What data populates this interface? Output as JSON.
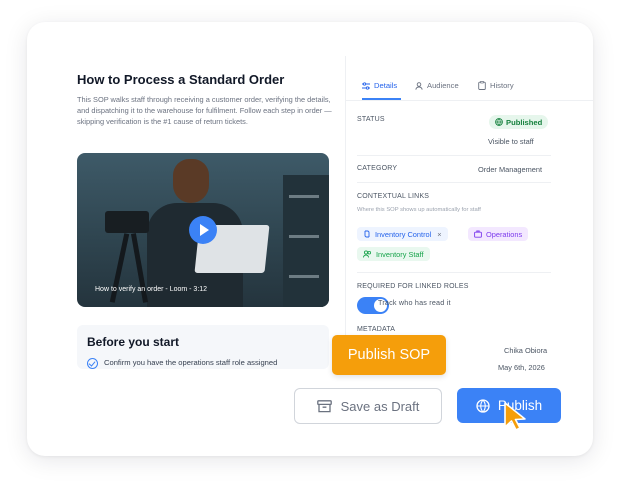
{
  "sop": {
    "title": "How to Process a Standard Order",
    "description": "This SOP walks staff through receiving a customer order, verifying the details, and dispatching it to the warehouse for fulfilment. Follow each step in order — skipping verification is the #1 cause of return tickets.",
    "video_caption": "How to verify an order - Loom - 3:12",
    "before_title": "Before you start",
    "checklist_item": "Confirm you have the operations staff role assigned"
  },
  "tabs": [
    {
      "label": "Details",
      "icon": "sliders-icon",
      "active": true
    },
    {
      "label": "Audience",
      "icon": "user-icon",
      "active": false
    },
    {
      "label": "History",
      "icon": "clipboard-icon",
      "active": false
    }
  ],
  "details": {
    "status_label": "STATUS",
    "status_badge": "Published",
    "status_sub": "Visible to staff",
    "category_label": "CATEGORY",
    "category_value": "Order Management",
    "links_label": "CONTEXTUAL LINKS",
    "links_help": "Where this SOP shows up automatically for staff",
    "chips": [
      {
        "label": "Inventory Control",
        "icon": "link-icon",
        "color": "#2563eb"
      },
      {
        "label": "Operations",
        "icon": "briefcase-icon",
        "color": "#7c3aed"
      },
      {
        "label": "Inventory Staff",
        "icon": "users-icon",
        "color": "#16a34a"
      }
    ],
    "required_label": "REQUIRED FOR LINKED ROLES",
    "toggle_text": "Track who has read it",
    "toggle_on": true,
    "metadata_label": "METADATA",
    "author": "Chika Obiora",
    "date": "May 6th, 2026"
  },
  "tooltip": "Publish SOP",
  "buttons": {
    "draft": "Save as Draft",
    "publish": "Publish"
  },
  "colors": {
    "accent": "#3b82f6",
    "tooltip": "#f59e0b",
    "published": "#15803d"
  }
}
